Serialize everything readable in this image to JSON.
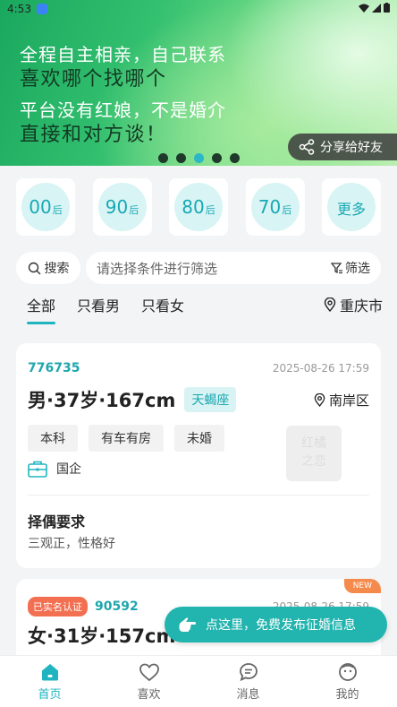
{
  "status_bar": {
    "time": "4:53"
  },
  "banner": {
    "lines": [
      "全程自主相亲，自己联系",
      "喜欢哪个找哪个",
      "平台没有红娘，不是婚介",
      "直接和对方谈！"
    ],
    "share_label": "分享给好友",
    "slide_count": 5,
    "active_slide": 3
  },
  "age_filters": [
    {
      "num": "00",
      "suffix": "后"
    },
    {
      "num": "90",
      "suffix": "后"
    },
    {
      "num": "80",
      "suffix": "后"
    },
    {
      "num": "70",
      "suffix": "后"
    }
  ],
  "age_more_label": "更多",
  "search": {
    "button_label": "搜索",
    "placeholder": "请选择条件进行筛选",
    "filter_label": "筛选"
  },
  "tabs": {
    "items": [
      "全部",
      "只看男",
      "只看女"
    ],
    "active": 0,
    "city": "重庆市"
  },
  "profiles": [
    {
      "id": "776735",
      "date": "2025-08-26 17:59",
      "summary": "男·37岁·167cm",
      "zodiac": "天蝎座",
      "district": "南岸区",
      "tags": [
        "本科",
        "有车有房",
        "未婚"
      ],
      "job": "国企",
      "watermark": "红橘之恋",
      "req_title": "择偶要求",
      "req_text": "三观正，性格好"
    },
    {
      "badge": "NEW",
      "verified": "已实名认证",
      "id": "90592",
      "date": "2025-08-26 17:59",
      "summary": "女·31岁·157cm"
    }
  ],
  "cta_label": "点这里，免费发布征婚信息",
  "bottom_nav": [
    {
      "label": "首页",
      "icon": "home-icon",
      "active": true
    },
    {
      "label": "喜欢",
      "icon": "heart-icon",
      "active": false
    },
    {
      "label": "消息",
      "icon": "message-icon",
      "active": false
    },
    {
      "label": "我的",
      "icon": "profile-icon",
      "active": false
    }
  ],
  "colors": {
    "accent": "#1fb5c0",
    "cta": "#22b4ae",
    "new_badge": "#f58a4d",
    "verified": "#f36f51"
  }
}
